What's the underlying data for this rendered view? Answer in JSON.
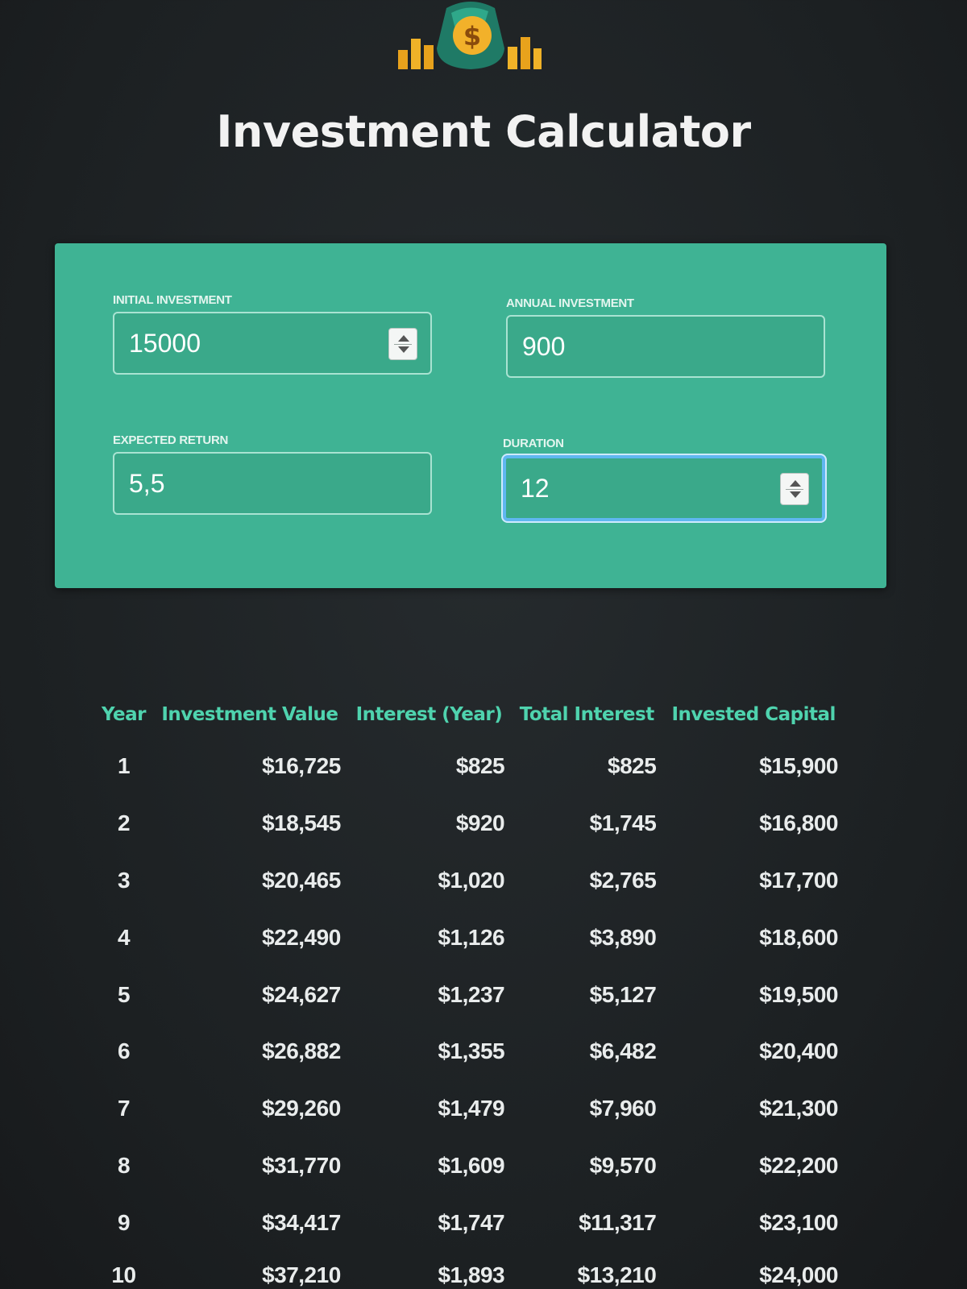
{
  "header": {
    "title": "Investment Calculator"
  },
  "inputs": {
    "initial_investment": {
      "label": "Initial Investment",
      "value": "15000"
    },
    "annual_investment": {
      "label": "Annual Investment",
      "value": "900"
    },
    "expected_return": {
      "label": "Expected Return",
      "value": "5,5"
    },
    "duration": {
      "label": "Duration",
      "value": "12"
    }
  },
  "results": {
    "columns": [
      "Year",
      "Investment Value",
      "Interest (Year)",
      "Total Interest",
      "Invested Capital"
    ],
    "rows": [
      [
        "1",
        "$16,725",
        "$825",
        "$825",
        "$15,900"
      ],
      [
        "2",
        "$18,545",
        "$920",
        "$1,745",
        "$16,800"
      ],
      [
        "3",
        "$20,465",
        "$1,020",
        "$2,765",
        "$17,700"
      ],
      [
        "4",
        "$22,490",
        "$1,126",
        "$3,890",
        "$18,600"
      ],
      [
        "5",
        "$24,627",
        "$1,237",
        "$5,127",
        "$19,500"
      ],
      [
        "6",
        "$26,882",
        "$1,355",
        "$6,482",
        "$20,400"
      ],
      [
        "7",
        "$29,260",
        "$1,479",
        "$7,960",
        "$21,300"
      ],
      [
        "8",
        "$31,770",
        "$1,609",
        "$9,570",
        "$22,200"
      ],
      [
        "9",
        "$34,417",
        "$1,747",
        "$11,317",
        "$23,100"
      ],
      [
        "10",
        "$37,210",
        "$1,893",
        "$13,210",
        "$24,000"
      ]
    ]
  },
  "icons": {
    "logo": "money-bag-icon"
  },
  "colors": {
    "panel": "#3fb394",
    "header_text": "#4fd3ae",
    "background": "#1f2326"
  }
}
